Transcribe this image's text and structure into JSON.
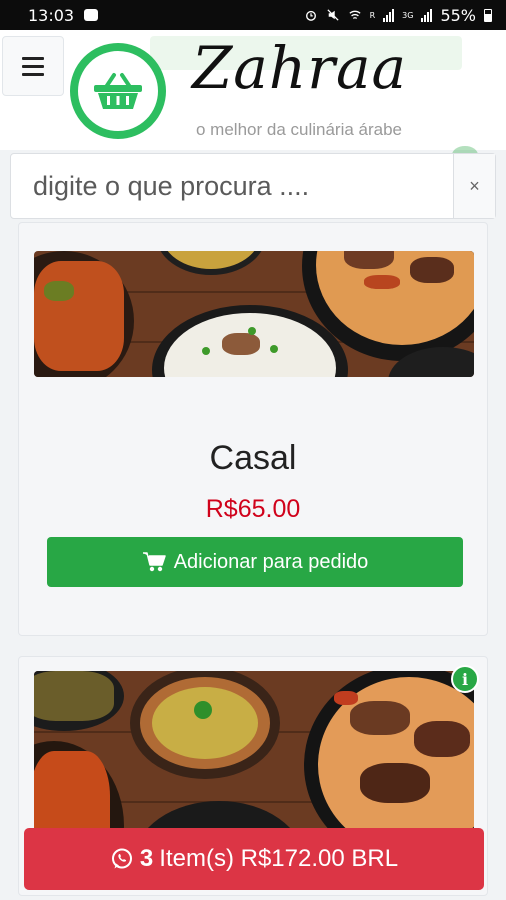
{
  "status_bar": {
    "time": "13:03",
    "battery": "55%",
    "network_labels": [
      "R",
      "3G"
    ]
  },
  "brand": {
    "name": "Zahraa",
    "tagline": "o melhor da culinária árabe",
    "color": "#2dbe60"
  },
  "search": {
    "placeholder": "digite o que procura ....",
    "clear_label": "×"
  },
  "products": [
    {
      "name": "Casal",
      "price": "R$65.00",
      "add_button_label": "Adicionar para pedido"
    },
    {
      "info_label": "i"
    }
  ],
  "cart": {
    "count": "3",
    "summary": "Item(s) R$172.00 BRL"
  },
  "colors": {
    "accent_green": "#28a745",
    "price_red": "#d0021b",
    "cart_red": "#dc3545"
  },
  "icons": [
    "menu-icon",
    "basket-icon",
    "cart-icon",
    "whatsapp-icon",
    "info-icon",
    "close-icon"
  ]
}
